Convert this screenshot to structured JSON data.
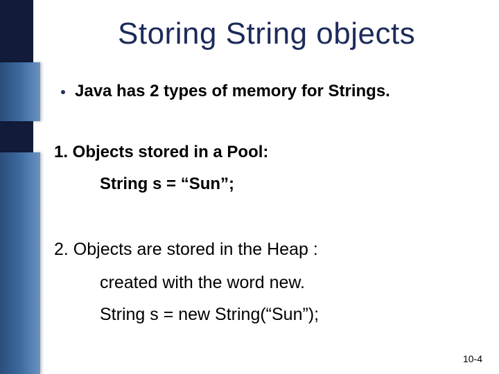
{
  "title": "Storing String objects",
  "bullet": "Java has 2 types of memory for Strings.",
  "item1": {
    "head": "1.  Objects stored in a Pool:",
    "sub": "String s = “Sun”;"
  },
  "item2": {
    "head": "2.  Objects are stored in the Heap :",
    "sub1": "created with the word new.",
    "sub2": "String s = new String(“Sun”);"
  },
  "page": "10-4"
}
